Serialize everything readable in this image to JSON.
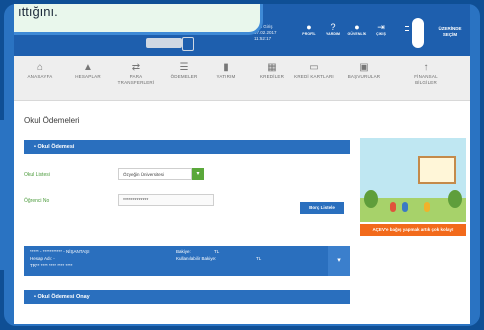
{
  "tooltip": {
    "text": "ıttığını."
  },
  "header": {
    "session": [
      "Son Giriş",
      "07.02.2017",
      "11:52:17"
    ],
    "tools": [
      {
        "icon": "●",
        "label": "PROFİL",
        "name": "profile"
      },
      {
        "icon": "?",
        "label": "YARDIM",
        "name": "help"
      },
      {
        "icon": "●",
        "label": "GÜVENLİK",
        "name": "security"
      },
      {
        "icon": "⇥",
        "label": "ÇIKIŞ",
        "name": "logout"
      }
    ],
    "customer": [
      "ÜZERİNDE",
      "SEÇİM"
    ]
  },
  "nav": {
    "items": [
      {
        "icon": "⌂",
        "label": "ANASAYFA",
        "name": "home"
      },
      {
        "icon": "▲",
        "label": "HESAPLAR",
        "name": "accounts"
      },
      {
        "icon": "⇄",
        "label": "PARA TRANSFERLERİ",
        "name": "transfers"
      },
      {
        "icon": "☰",
        "label": "ÖDEMELER",
        "name": "payments"
      },
      {
        "icon": "▮",
        "label": "YATIRIM",
        "name": "investment"
      },
      {
        "icon": "▦",
        "label": "KREDİLER",
        "name": "credits"
      },
      {
        "icon": "▭",
        "label": "KREDİ KARTLARI",
        "name": "credit-cards"
      },
      {
        "icon": "▣",
        "label": "BAŞVURULAR",
        "name": "applications"
      },
      {
        "icon": "↑",
        "label": "FİNANSAL BİLGİLER",
        "name": "financial-info"
      }
    ]
  },
  "page": {
    "title": "Okul Ödemeleri",
    "section1": "Okul Ödemesi",
    "school_label": "Okul Listesi",
    "school_value": "Özyeğin Üniversitesi",
    "student_label": "Öğrenci No",
    "student_value": "*************",
    "list_button": "Borç Listele",
    "section2": "Okul Ödemesi Onay"
  },
  "account": {
    "line1": "***** - *********** - NİŞANTAŞI",
    "line2": "Hesap Adı: -",
    "line3": "TR** **** **** **** ****",
    "balance_label": "Bakiye:",
    "balance_value": "TL",
    "avail_label": "Kullanılabilir Bakiye:",
    "avail_value": "TL"
  },
  "promo": {
    "cta": "AÇEV'e bağış yapmak artık çok kolay!"
  }
}
